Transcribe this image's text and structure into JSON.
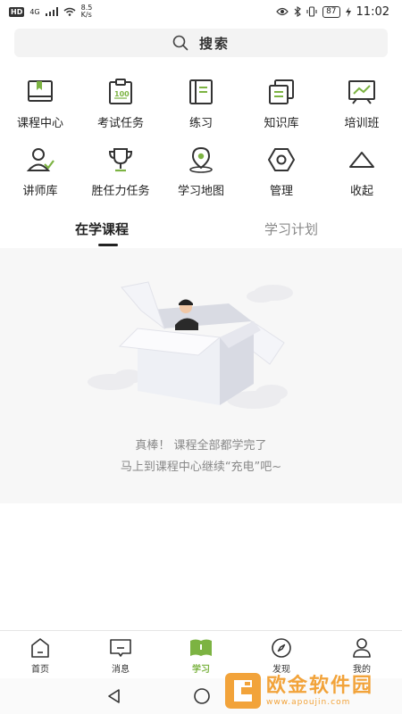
{
  "status_bar": {
    "hd": "HD",
    "signal": "4G",
    "net_speed_value": "8.5",
    "net_speed_unit": "K/s",
    "battery": "87",
    "time": "11:02"
  },
  "search": {
    "label": "搜索"
  },
  "grid": {
    "items": [
      {
        "label": "课程中心",
        "icon": "book-icon"
      },
      {
        "label": "考试任务",
        "icon": "exam-clipboard-icon"
      },
      {
        "label": "练习",
        "icon": "practice-notebook-icon"
      },
      {
        "label": "知识库",
        "icon": "knowledge-docs-icon"
      },
      {
        "label": "培训班",
        "icon": "training-board-icon"
      },
      {
        "label": "讲师库",
        "icon": "lecturer-icon"
      },
      {
        "label": "胜任力任务",
        "icon": "trophy-icon"
      },
      {
        "label": "学习地图",
        "icon": "map-pin-icon"
      },
      {
        "label": "管理",
        "icon": "hexagon-nut-icon"
      },
      {
        "label": "收起",
        "icon": "collapse-triangle-icon"
      }
    ]
  },
  "tabs": [
    {
      "label": "在学课程",
      "active": true
    },
    {
      "label": "学习计划",
      "active": false
    }
  ],
  "empty_state": {
    "line1": "真棒！ 课程全部都学完了",
    "line2": "马上到课程中心继续“充电”吧~"
  },
  "bottom_nav": [
    {
      "label": "首页",
      "icon": "home-icon",
      "active": false
    },
    {
      "label": "消息",
      "icon": "message-icon",
      "active": false
    },
    {
      "label": "学习",
      "icon": "study-book-icon",
      "active": true
    },
    {
      "label": "发现",
      "icon": "compass-icon",
      "active": false
    },
    {
      "label": "我的",
      "icon": "profile-icon",
      "active": false
    }
  ],
  "colors": {
    "accent": "#7cb342",
    "text": "#222222",
    "muted": "#888888"
  },
  "watermark": {
    "title": "欧金软件园",
    "url": "www.apoujin.com"
  }
}
